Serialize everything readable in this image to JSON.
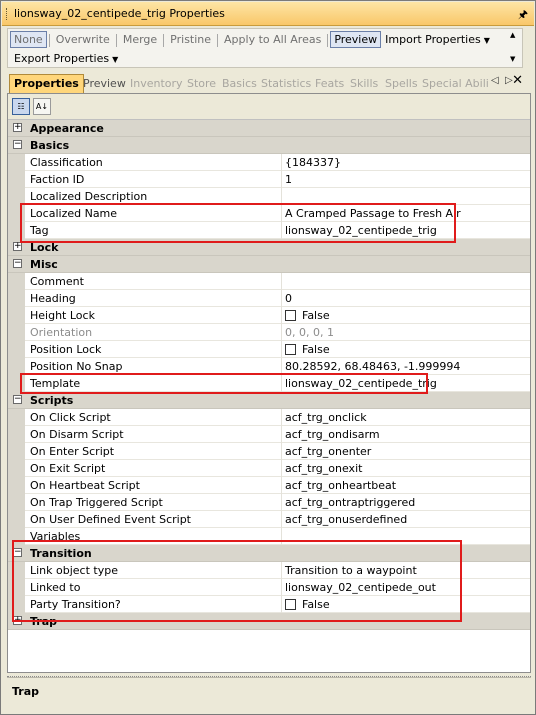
{
  "window": {
    "title": "lionsway_02_centipede_trig Properties",
    "pin_icon": "pin-icon"
  },
  "toolbar": {
    "row1": [
      {
        "label": "None",
        "enabled": false,
        "boxed": true
      },
      {
        "label": "Overwrite",
        "enabled": false
      },
      {
        "label": "Merge",
        "enabled": false
      },
      {
        "label": "Pristine",
        "enabled": false
      },
      {
        "label": "Apply to All Areas",
        "enabled": false
      },
      {
        "label": "Preview",
        "enabled": true,
        "boxed": true
      },
      {
        "label": "Import Properties",
        "enabled": true,
        "dropdown": true
      }
    ],
    "row2": [
      {
        "label": "Export Properties",
        "enabled": true,
        "dropdown": true
      }
    ]
  },
  "tabs": {
    "active": "Properties",
    "preview": "Preview",
    "disabled": [
      "Inventory",
      "Store",
      "Basics",
      "Statistics",
      "Feats",
      "Skills",
      "Spells",
      "Special Abili"
    ]
  },
  "grid": {
    "appearance": "Appearance",
    "basics": {
      "title": "Basics",
      "classification_name": "Classification",
      "classification_value": "{184337}",
      "faction_name": "Faction ID",
      "faction_value": "1",
      "localized_desc_name": "Localized Description",
      "localized_desc_value": "",
      "localized_name_name": "Localized Name",
      "localized_name_value": "A Cramped Passage to Fresh Air",
      "tag_name": "Tag",
      "tag_value": "lionsway_02_centipede_trig"
    },
    "lock": "Lock",
    "misc": {
      "title": "Misc",
      "comment_name": "Comment",
      "comment_value": "",
      "heading_name": "Heading",
      "heading_value": "0",
      "height_lock_name": "Height Lock",
      "height_lock_value": "False",
      "orientation_name": "Orientation",
      "orientation_value": "0, 0, 0, 1",
      "position_lock_name": "Position Lock",
      "position_lock_value": "False",
      "position_no_snap_name": "Position No Snap",
      "position_no_snap_value": "80.28592, 68.48463, -1.999994",
      "template_name": "Template",
      "template_value": "lionsway_02_centipede_trig"
    },
    "scripts": {
      "title": "Scripts",
      "on_click_name": "On Click Script",
      "on_click_value": "acf_trg_onclick",
      "on_disarm_name": "On Disarm Script",
      "on_disarm_value": "acf_trg_ondisarm",
      "on_enter_name": "On Enter Script",
      "on_enter_value": "acf_trg_onenter",
      "on_exit_name": "On Exit Script",
      "on_exit_value": "acf_trg_onexit",
      "on_heartbeat_name": "On Heartbeat Script",
      "on_heartbeat_value": "acf_trg_onheartbeat",
      "on_trap_triggered_name": "On Trap Triggered Script",
      "on_trap_triggered_value": "acf_trg_ontraptriggered",
      "on_user_defined_name": "On User Defined Event Script",
      "on_user_defined_value": "acf_trg_onuserdefined",
      "variables_name": "Variables",
      "variables_value": ""
    },
    "transition": {
      "title": "Transition",
      "link_type_name": "Link object type",
      "link_type_value": "Transition to a waypoint",
      "linked_to_name": "Linked to",
      "linked_to_value": "lionsway_02_centipede_out",
      "party_name": "Party Transition?",
      "party_value": "False"
    },
    "trap": "Trap"
  },
  "description": {
    "title": "Trap"
  }
}
